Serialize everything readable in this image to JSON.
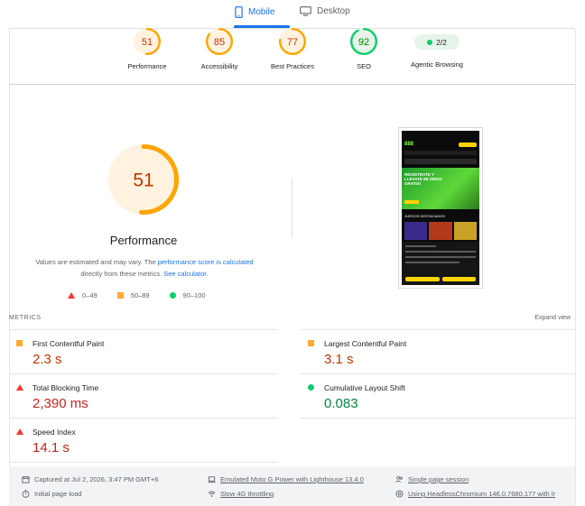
{
  "tabs": [
    {
      "label": "Mobile",
      "icon": "smartphone-icon",
      "active": true
    },
    {
      "label": "Desktop",
      "icon": "monitor-icon",
      "active": false
    }
  ],
  "summary": [
    {
      "score": "51",
      "label": "Performance",
      "color": "#ffa400",
      "fraction": 0.51
    },
    {
      "score": "85",
      "label": "Accessibility",
      "color": "#ffa400",
      "fraction": 0.85
    },
    {
      "score": "77",
      "label": "Best Practices",
      "color": "#ffa400",
      "fraction": 0.77
    },
    {
      "score": "92",
      "label": "SEO",
      "color": "#0cce6b",
      "fraction": 0.92
    },
    {
      "score": "2/2",
      "label": "Agentic Browsing",
      "color": "#0cce6b"
    }
  ],
  "performance": {
    "score": "51",
    "fraction": 0.51,
    "title": "Performance",
    "desc_1": "Values are estimated and may vary. The ",
    "desc_link_1": "performance score is calculated",
    "desc_2": "directly from these metrics. ",
    "desc_link_2": "See calculator."
  },
  "legend": [
    {
      "shape": "triangle",
      "range": "0–49",
      "color": "#ff3333"
    },
    {
      "shape": "square",
      "range": "50–89",
      "color": "#ffaa33"
    },
    {
      "shape": "circle",
      "range": "90–100",
      "color": "#0cce6b"
    }
  ],
  "screenshot": {
    "logo": "888",
    "banner_text": "REGÍSTRATE Y LLÉVATE 88 GIROS GRATIS!",
    "section": "JUEGOS DESTACADOS"
  },
  "metrics": {
    "title": "METRICS",
    "expand": "Expand view",
    "items": [
      {
        "label": "First Contentful Paint",
        "value": "2.3 s",
        "rating": "average"
      },
      {
        "label": "Largest Contentful Paint",
        "value": "3.1 s",
        "rating": "average"
      },
      {
        "label": "Total Blocking Time",
        "value": "2,390 ms",
        "rating": "fail"
      },
      {
        "label": "Cumulative Layout Shift",
        "value": "0.083",
        "rating": "pass"
      },
      {
        "label": "Speed Index",
        "value": "14.1 s",
        "rating": "fail"
      }
    ]
  },
  "footer": {
    "captured": "Captured at Jul 2, 2026, 3:47 PM GMT+6",
    "initial_load": "Initial page load",
    "device": "Emulated Moto G Power with Lighthouse 13.4.0",
    "throttling": "Slow 4G throttling",
    "session": "Single page session",
    "browser": "Using HeadlessChromium 146.0.7680.177 with lr"
  }
}
